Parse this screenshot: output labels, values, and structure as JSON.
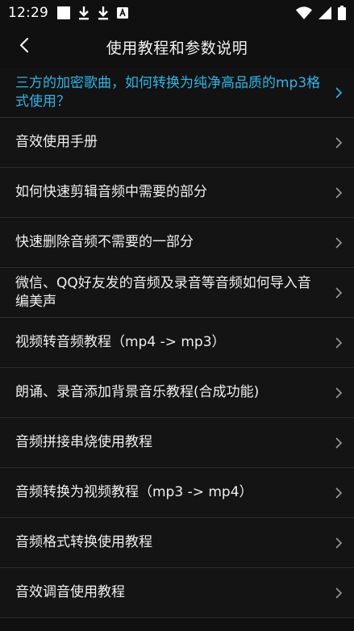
{
  "status_bar": {
    "time": "12:29",
    "left_icons": [
      "notification-square-icon",
      "download-icon",
      "download-icon",
      "a-badge-icon"
    ],
    "right_icons": [
      "wifi-icon",
      "cellular-signal-icon",
      "battery-icon"
    ]
  },
  "header": {
    "title": "使用教程和参数说明",
    "back_icon": "chevron-left-icon"
  },
  "colors": {
    "background": "#101010",
    "highlight": "#2ab7e8",
    "divider": "#2c2c2c",
    "text": "#efefef"
  },
  "tutorials": [
    {
      "label": "三方的加密歌曲，如何转换为纯净高品质的mp3格式使用？",
      "highlight": true
    },
    {
      "label": "音效使用手册"
    },
    {
      "label": "如何快速剪辑音频中需要的部分"
    },
    {
      "label": "快速删除音频不需要的一部分"
    },
    {
      "label": "微信、QQ好友发的音频及录音等音频如何导入音编美声"
    },
    {
      "label": "视频转音频教程（mp4 -> mp3）"
    },
    {
      "label": "朗诵、录音添加背景音乐教程(合成功能)"
    },
    {
      "label": "音频拼接串烧使用教程"
    },
    {
      "label": "音频转换为视频教程（mp3 -> mp4）"
    },
    {
      "label": "音频格式转换使用教程"
    },
    {
      "label": "音效调音使用教程"
    }
  ]
}
